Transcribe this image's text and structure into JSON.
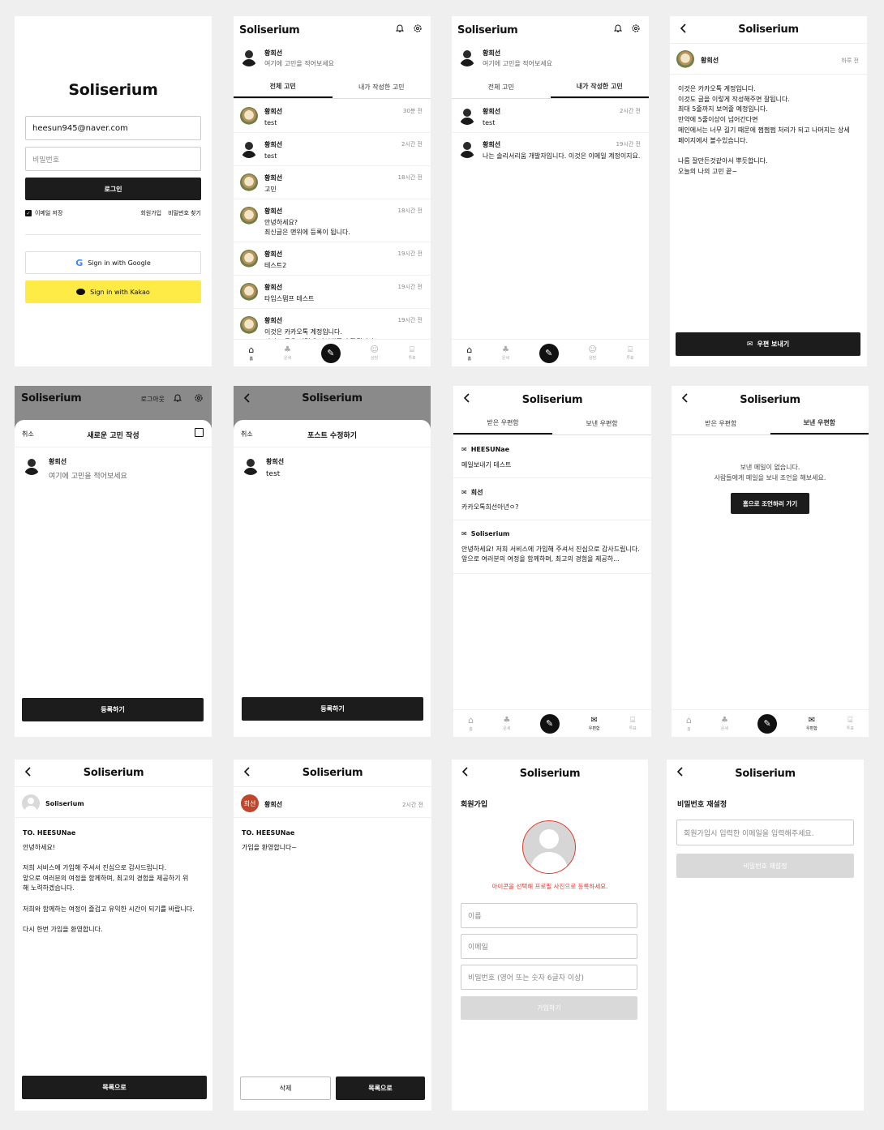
{
  "brand": "Soliserium",
  "login": {
    "email_value": "heesun945@naver.com",
    "password_placeholder": "비밀번호",
    "login_button": "로그인",
    "remember_email": "이메일 저장",
    "signup_link": "회원가입",
    "find_password_link": "비밀번호 찾기",
    "google_button": "Sign in with Google",
    "kakao_button": "Sign in with Kakao",
    "kakao_color": "#FEEB46"
  },
  "feed": {
    "user_name": "황희선",
    "prompt": "여기에 고민을 적어보세요",
    "tab_all": "전체 고민",
    "tab_mine": "내가 작성한 고민",
    "posts": [
      {
        "name": "황희선",
        "time": "30분 전",
        "text": "test",
        "avatar": "deco"
      },
      {
        "name": "황희선",
        "time": "2시간 전",
        "text": "test",
        "avatar": "person"
      },
      {
        "name": "황희선",
        "time": "18시간 전",
        "text": "고민",
        "avatar": "deco"
      },
      {
        "name": "황희선",
        "time": "18시간 전",
        "text": "안녕하세요?\n최신글은 맨위에 등록이 됩니다.",
        "avatar": "deco"
      },
      {
        "name": "황희선",
        "time": "19시간 전",
        "text": "테스트2",
        "avatar": "deco"
      },
      {
        "name": "황희선",
        "time": "19시간 전",
        "text": "타임스탬프 테스트",
        "avatar": "deco"
      },
      {
        "name": "황희선",
        "time": "19시간 전",
        "text": "이것은 카카오톡 계정입니다.\n이것도 글을 이렇게 작성해주면 잘됩니다",
        "avatar": "deco"
      }
    ],
    "my_posts": [
      {
        "name": "황희선",
        "time": "2시간 전",
        "text": "test"
      },
      {
        "name": "황희선",
        "time": "19시간 전",
        "text": "나는 솔리서리움 개발자입니다. 이것은 이메일 계정이지요."
      }
    ]
  },
  "nav": {
    "home": "홈",
    "fortune": "운세",
    "consult": "상담",
    "vote": "투표",
    "mailbox": "우편함"
  },
  "detail": {
    "name": "황희선",
    "time": "하루 전",
    "body": "이것은 카카오톡 계정입니다.\n이것도 글을 이렇게 작성해주면 잘됩니다.\n최대 5줄까지 보여줄 예정입니다.\n만약에 5줄이상이 넘어간다면\n메인에서는 너무 길기 때문에 쩜쩜쩜 처리가 되고 나머지는 상세\n페이지에서 볼수있습니다.\n\n나름 잘만든것같아서 뿌듯합니다.\n오늘의 나의 고민 끝~",
    "send_mail_button": "우편 보내기"
  },
  "header_extra": {
    "logout": "로그아웃"
  },
  "compose": {
    "cancel": "취소",
    "title": "새로운 고민 작성",
    "name": "황희선",
    "placeholder": "여기에 고민을 적어보세요",
    "submit": "등록하기"
  },
  "edit": {
    "cancel": "취소",
    "title": "포스트 수정하기",
    "name": "황희선",
    "text": "test",
    "submit": "등록하기"
  },
  "mailbox": {
    "tab_received": "받은 우편함",
    "tab_sent": "보낸 우편함",
    "mails": [
      {
        "from": "HEESUNae",
        "body": "메일보내기 테스트"
      },
      {
        "from": "희선",
        "body": "카카오톡희선아년ㅇ?"
      },
      {
        "from": "Soliserium",
        "body": "안녕하세요! 저희 서비스에 가입해 주셔서 진심으로 감사드립니다. 앞으로 여러분의 여정을 함께하며, 최고의 경험을 제공하..."
      }
    ],
    "empty_line1": "보낸 메일이 없습니다.",
    "empty_line2": "사람들에게 메일을 보내 조언을 해보세요.",
    "go_home_button": "홈으로 조언하러 가기"
  },
  "mail_detail_1": {
    "sender": "Soliserium",
    "to": "TO. HEESUNae",
    "body": "안녕하세요!\n\n저희 서비스에 가입해 주셔서 진심으로 감사드립니다.\n앞으로 여러분의 여정을 함께하며, 최고의 경험을 제공하기 위\n해 노력하겠습니다.\n\n저희와 함께하는 여정이 즐겁고 유익한 시간이 되기를 바랍니다.\n\n다시 한번 가입을 환영합니다.",
    "list_button": "목록으로"
  },
  "mail_detail_2": {
    "avatar_text": "희선",
    "sender": "황희선",
    "time": "2시간 전",
    "to": "TO. HEESUNae",
    "body": "가입을 환영합니다~",
    "delete_button": "삭제",
    "list_button": "목록으로"
  },
  "signup": {
    "title": "회원가입",
    "photo_hint": "아이콘을 선택해 프로필 사진으로 등록하세요.",
    "name_placeholder": "이름",
    "email_placeholder": "이메일",
    "password_placeholder": "비밀번호 (영어 또는 숫자 6글자 이상)",
    "submit": "가입하기"
  },
  "reset": {
    "title": "비밀번호 재설정",
    "email_placeholder": "회원가입시 입력한 이메일을 입력해주세요.",
    "submit": "비밀번호 재설정"
  }
}
